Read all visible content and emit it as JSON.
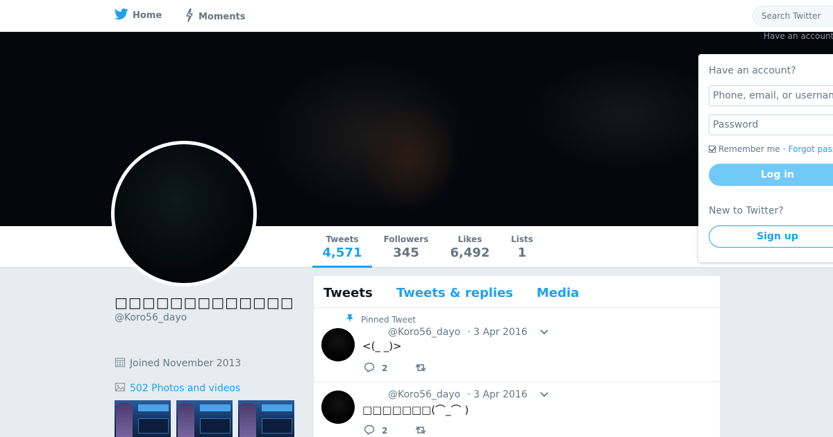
{
  "topnav": {
    "home_label": "Home",
    "moments_label": "Moments",
    "search_placeholder": "Search Twitter",
    "have_account_hint": "Have an account?"
  },
  "profile": {
    "name": "□□□□□□□□□□□□□",
    "handle": "@Koro56_dayo",
    "joined": "Joined November 2013",
    "photos_label": "502 Photos and videos"
  },
  "stats": [
    {
      "label": "Tweets",
      "value": "4,571"
    },
    {
      "label": "Followers",
      "value": "345"
    },
    {
      "label": "Likes",
      "value": "6,492"
    },
    {
      "label": "Lists",
      "value": "1"
    }
  ],
  "timeline": {
    "tabs": [
      "Tweets",
      "Tweets & replies",
      "Media"
    ],
    "pinned_label": "Pinned Tweet",
    "tweets": [
      {
        "handle": "@Koro56_dayo",
        "date": "· 3 Apr 2016",
        "text": "<(_ _)>",
        "replies": "2"
      },
      {
        "handle": "@Koro56_dayo",
        "date": "· 3 Apr 2016",
        "text": "□□□□□□□(⌒_⌒ )",
        "replies": "2"
      }
    ]
  },
  "login": {
    "title": "Have an account?",
    "phone_placeholder": "Phone, email, or username",
    "password_placeholder": "Password",
    "remember_label": "Remember me",
    "separator": "·",
    "forgot_label": "Forgot password?",
    "login_button": "Log in",
    "new_label": "New to Twitter?",
    "signup_button": "Sign up"
  },
  "colors": {
    "accent": "#1da1f2",
    "background": "#e6ecf0",
    "banner": "#05070c"
  }
}
